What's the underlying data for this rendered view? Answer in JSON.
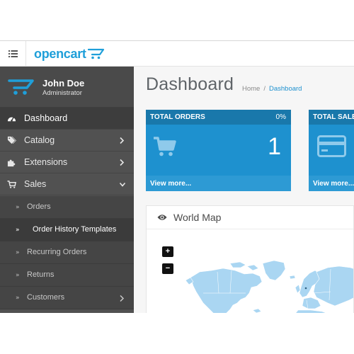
{
  "header": {
    "menu_icon": "list-menu-icon",
    "logo_text": "opencart",
    "logo_icon": "cart-icon"
  },
  "sidebar": {
    "user_name": "John Doe",
    "user_role": "Administrator",
    "avatar_icon": "opencart-logo-icon",
    "items": [
      {
        "label": "Dashboard",
        "icon": "dashboard-icon",
        "active": true
      },
      {
        "label": "Catalog",
        "icon": "tags-icon",
        "expandable": true
      },
      {
        "label": "Extensions",
        "icon": "puzzle-icon",
        "expandable": true
      },
      {
        "label": "Sales",
        "icon": "shopping-cart-icon",
        "expanded": true
      }
    ],
    "sales_children": [
      {
        "label": "Orders"
      },
      {
        "label": "Order History Templates",
        "current": true
      },
      {
        "label": "Recurring Orders"
      },
      {
        "label": "Returns"
      },
      {
        "label": "Customers",
        "expandable": true
      }
    ]
  },
  "main": {
    "page_title": "Dashboard",
    "breadcrumb": {
      "home": "Home",
      "separator": "/",
      "current": "Dashboard"
    },
    "tiles": [
      {
        "heading": "TOTAL ORDERS",
        "percent": "0%",
        "value": "1",
        "footer": "View more...",
        "icon": "shopping-cart-icon"
      },
      {
        "heading": "TOTAL SALES",
        "percent": "",
        "value": "",
        "footer": "View more...",
        "icon": "credit-card-icon"
      }
    ],
    "map": {
      "title": "World Map",
      "icon": "eye-icon",
      "zoom_in": "+",
      "zoom_out": "−"
    }
  },
  "colors": {
    "brand_blue": "#1e91cf",
    "tile_heading": "#1978ab",
    "sidebar_bg": "#515151",
    "map_land": "#aad6f2"
  }
}
